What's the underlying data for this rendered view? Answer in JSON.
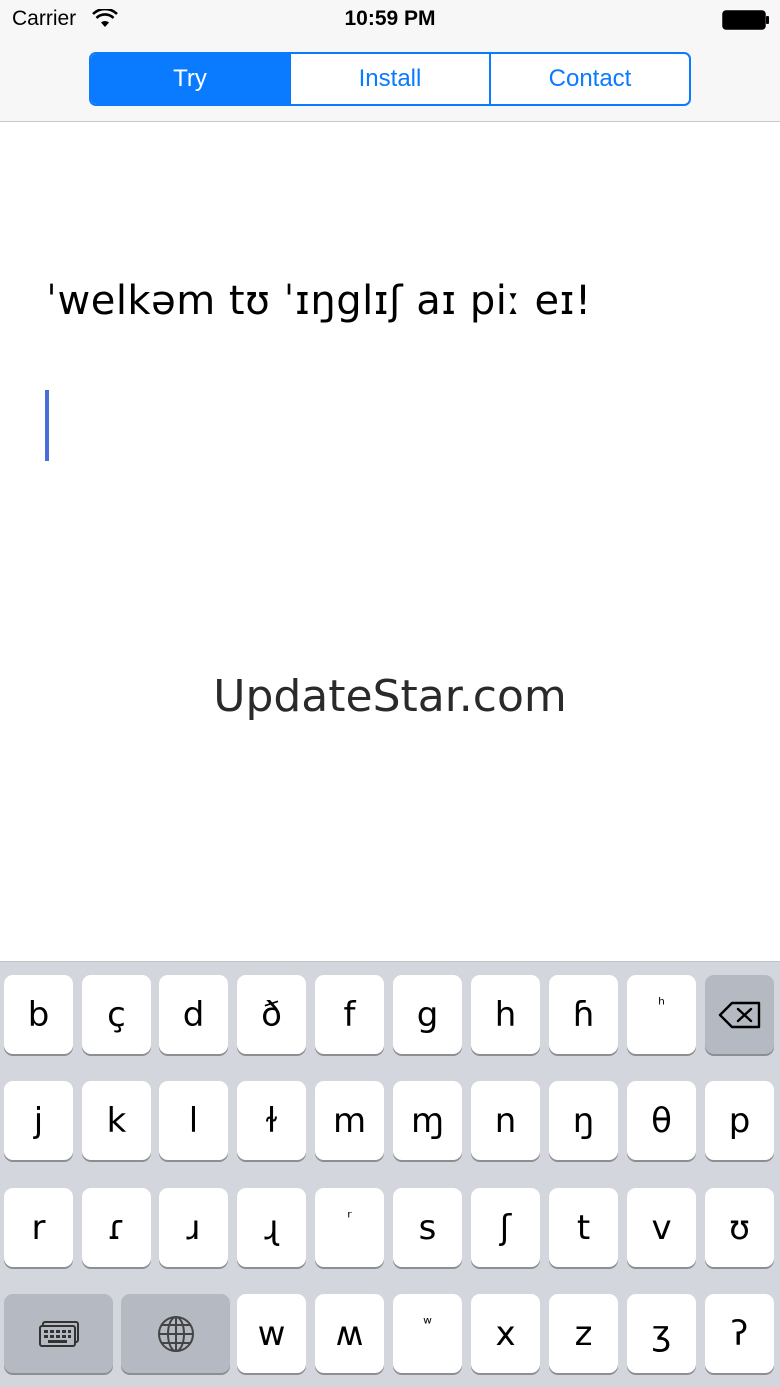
{
  "status_bar": {
    "carrier": "Carrier",
    "time": "10:59 PM",
    "wifi_icon": "wifi-icon",
    "battery_icon": "battery-icon"
  },
  "tabs": [
    {
      "label": "Try",
      "selected": true
    },
    {
      "label": "Install",
      "selected": false
    },
    {
      "label": "Contact",
      "selected": false
    }
  ],
  "content": {
    "ipa_text": "ˈwelkəm tʊ ˈɪŋglɪʃ aɪ piː eɪ!",
    "watermark": "UpdateStar.com"
  },
  "keyboard": {
    "row1": [
      "b",
      "ç",
      "d",
      "ð",
      "f",
      "g",
      "h",
      "ɦ",
      "ʰ"
    ],
    "row2": [
      "j",
      "k",
      "l",
      "ɫ",
      "m",
      "ɱ",
      "n",
      "ŋ",
      "θ",
      "p"
    ],
    "row3": [
      "r",
      "ɾ",
      "ɹ",
      "ɻ",
      "ʳ",
      "s",
      "ʃ",
      "t",
      "v",
      "ʊ"
    ],
    "row4": [
      "w",
      "ʍ",
      "ʷ",
      "x",
      "z",
      "ʒ",
      "ʔ"
    ],
    "icons": {
      "delete": "backspace-icon",
      "keyboard": "keyboard-icon",
      "globe": "globe-icon"
    }
  },
  "colors": {
    "accent": "#0a7aff",
    "keyboard_bg": "#d3d6dc",
    "cursor": "#4a6ed8"
  }
}
